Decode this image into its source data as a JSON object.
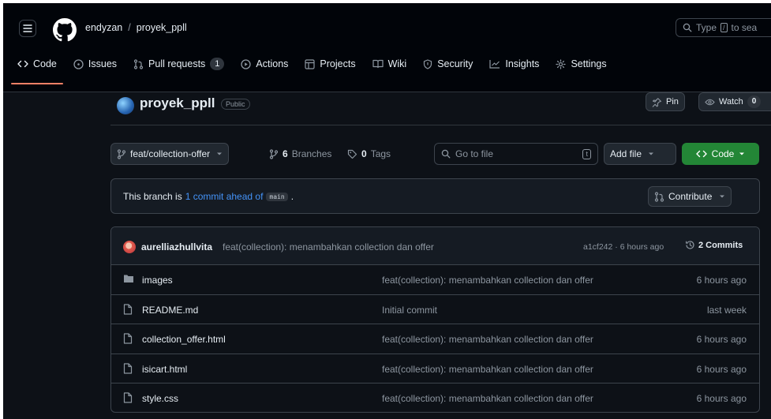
{
  "header": {
    "owner": "endyzan",
    "separator": "/",
    "repo": "proyek_ppll",
    "search_prefix": "Type",
    "search_key": "/",
    "search_suffix": "to sea"
  },
  "tabs": [
    {
      "label": "Code",
      "icon": "code-icon"
    },
    {
      "label": "Issues",
      "icon": "issue-icon"
    },
    {
      "label": "Pull requests",
      "icon": "pull-request-icon",
      "count": "1"
    },
    {
      "label": "Actions",
      "icon": "play-icon"
    },
    {
      "label": "Projects",
      "icon": "table-icon"
    },
    {
      "label": "Wiki",
      "icon": "book-icon"
    },
    {
      "label": "Security",
      "icon": "shield-icon"
    },
    {
      "label": "Insights",
      "icon": "graph-icon"
    },
    {
      "label": "Settings",
      "icon": "gear-icon"
    }
  ],
  "repo_header": {
    "name": "proyek_ppll",
    "visibility": "Public",
    "pin_label": "Pin",
    "watch_label": "Watch",
    "watch_count": "0"
  },
  "toolbar": {
    "branch": "feat/collection-offer",
    "branches_count": "6",
    "branches_label": "Branches",
    "tags_count": "0",
    "tags_label": "Tags",
    "go_to_file_placeholder": "Go to file",
    "go_to_file_key": "t",
    "add_file_label": "Add file",
    "code_label": "Code"
  },
  "branch_info": {
    "prefix": "This branch is",
    "ahead_link": "1 commit ahead of",
    "base": "main",
    "suffix": ".",
    "contribute_label": "Contribute"
  },
  "latest_commit": {
    "author": "aurelliazhullvita",
    "message": "feat(collection): menambahkan collection dan offer",
    "meta": "a1cf242 · 6 hours ago",
    "commits_label": "2 Commits"
  },
  "files": [
    {
      "type": "folder",
      "name": "images",
      "message": "feat(collection): menambahkan collection dan offer",
      "time": "6 hours ago"
    },
    {
      "type": "file",
      "name": "README.md",
      "message": "Initial commit",
      "time": "last week"
    },
    {
      "type": "file",
      "name": "collection_offer.html",
      "message": "feat(collection): menambahkan collection dan offer",
      "time": "6 hours ago"
    },
    {
      "type": "file",
      "name": "isicart.html",
      "message": "feat(collection): menambahkan collection dan offer",
      "time": "6 hours ago"
    },
    {
      "type": "file",
      "name": "style.css",
      "message": "feat(collection): menambahkan collection dan offer",
      "time": "6 hours ago"
    }
  ],
  "colors": {
    "background": "#0d1117",
    "header_bg": "#010409",
    "accent_green": "#238636",
    "link_blue": "#4493f8",
    "tab_underline": "#f78166"
  }
}
